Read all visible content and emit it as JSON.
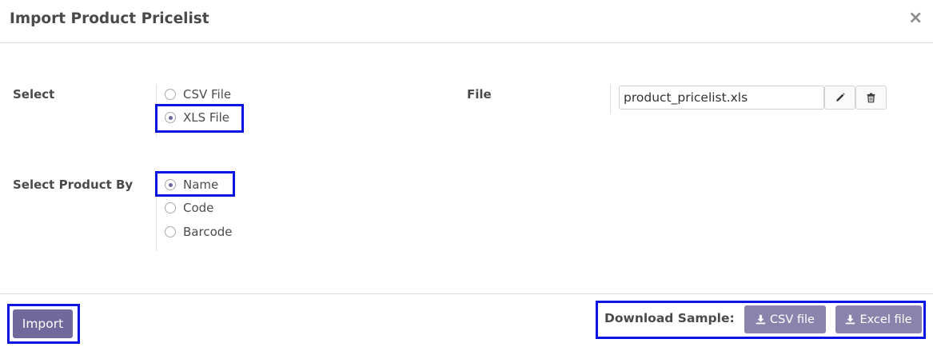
{
  "dialog": {
    "title": "Import Product Pricelist",
    "close_symbol": "×"
  },
  "import_type": {
    "label": "Select",
    "options": [
      "CSV File",
      "XLS File"
    ],
    "selected": "XLS File"
  },
  "file": {
    "label": "File",
    "value": "product_pricelist.xls",
    "edit_icon": "pencil-icon",
    "delete_icon": "trash-icon"
  },
  "product_by": {
    "label": "Select Product By",
    "options": [
      "Name",
      "Code",
      "Barcode"
    ],
    "selected": "Name"
  },
  "footer": {
    "import_label": "Import",
    "download_sample_label": "Download Sample:",
    "csv_sample_label": "CSV file",
    "excel_sample_label": "Excel file",
    "download_icon": "download-icon"
  },
  "colors": {
    "primary_button": "#71689b",
    "sample_button": "#8a84ad",
    "highlight_box": "#0a14e6"
  }
}
